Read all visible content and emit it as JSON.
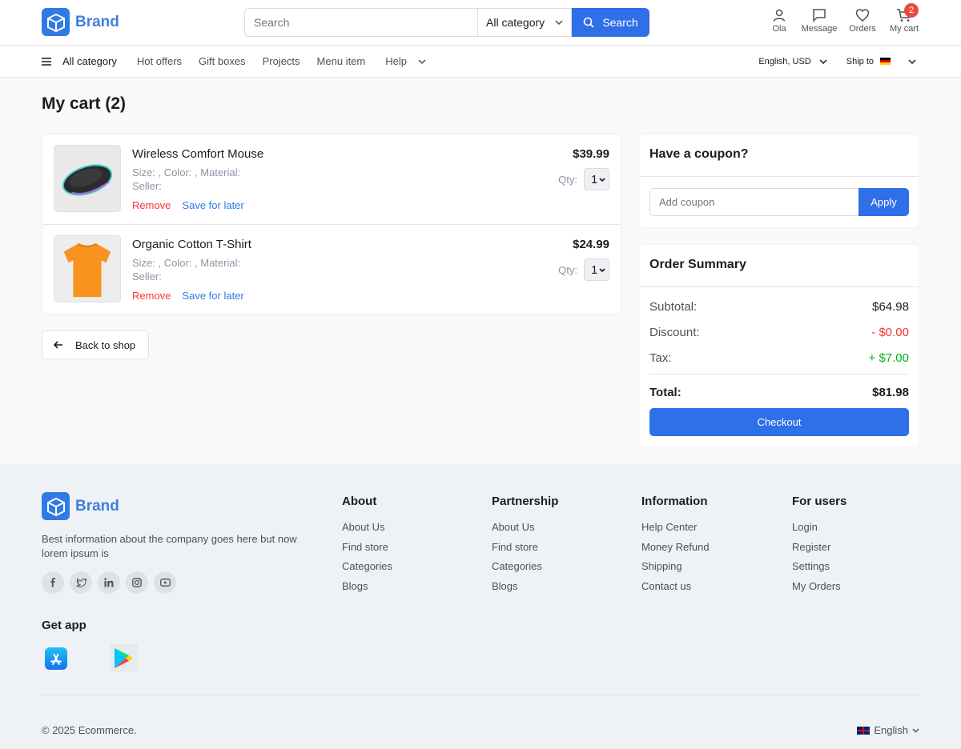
{
  "brand": {
    "name": "Brand"
  },
  "search": {
    "placeholder": "Search",
    "category": "All category",
    "button": "Search"
  },
  "header_actions": {
    "profile": "Ola",
    "message": "Message",
    "orders": "Orders",
    "cart": "My cart",
    "cart_count": "2"
  },
  "nav": {
    "all_category": "All category",
    "items": [
      "Hot offers",
      "Gift boxes",
      "Projects",
      "Menu item"
    ],
    "help": "Help",
    "language": "English, USD",
    "ship_to": "Ship to"
  },
  "page_title": "My cart (2)",
  "cart": {
    "items": [
      {
        "name": "Wireless Comfort Mouse",
        "meta1": "Size: , Color: , Material:",
        "meta2": "Seller:",
        "remove": "Remove",
        "save": "Save for later",
        "price": "$39.99",
        "qty_label": "Qty:",
        "qty": "1"
      },
      {
        "name": "Organic Cotton T-Shirt",
        "meta1": "Size: , Color: , Material:",
        "meta2": "Seller:",
        "remove": "Remove",
        "save": "Save for later",
        "price": "$24.99",
        "qty_label": "Qty:",
        "qty": "1"
      }
    ],
    "back": "Back to shop"
  },
  "coupon": {
    "title": "Have a coupon?",
    "placeholder": "Add coupon",
    "apply": "Apply"
  },
  "summary": {
    "title": "Order Summary",
    "subtotal_label": "Subtotal:",
    "subtotal": "$64.98",
    "discount_label": "Discount:",
    "discount": "- $0.00",
    "tax_label": "Tax:",
    "tax": "+ $7.00",
    "total_label": "Total:",
    "total": "$81.98",
    "checkout": "Checkout"
  },
  "footer": {
    "brand": "Brand",
    "description": "Best information about the company goes here but now lorem ipsum is",
    "get_app": "Get app",
    "columns": [
      {
        "title": "About",
        "links": [
          "About Us",
          "Find store",
          "Categories",
          "Blogs"
        ]
      },
      {
        "title": "Partnership",
        "links": [
          "About Us",
          "Find store",
          "Categories",
          "Blogs"
        ]
      },
      {
        "title": "Information",
        "links": [
          "Help Center",
          "Money Refund",
          "Shipping",
          "Contact us"
        ]
      },
      {
        "title": "For users",
        "links": [
          "Login",
          "Register",
          "Settings",
          "My Orders"
        ]
      }
    ],
    "copyright": "© 2025 Ecommerce.",
    "language": "English"
  },
  "colors": {
    "primary": "#2f6fe8",
    "brand": "#3f7fe0",
    "danger": "#fa3434",
    "success": "#00b517"
  }
}
